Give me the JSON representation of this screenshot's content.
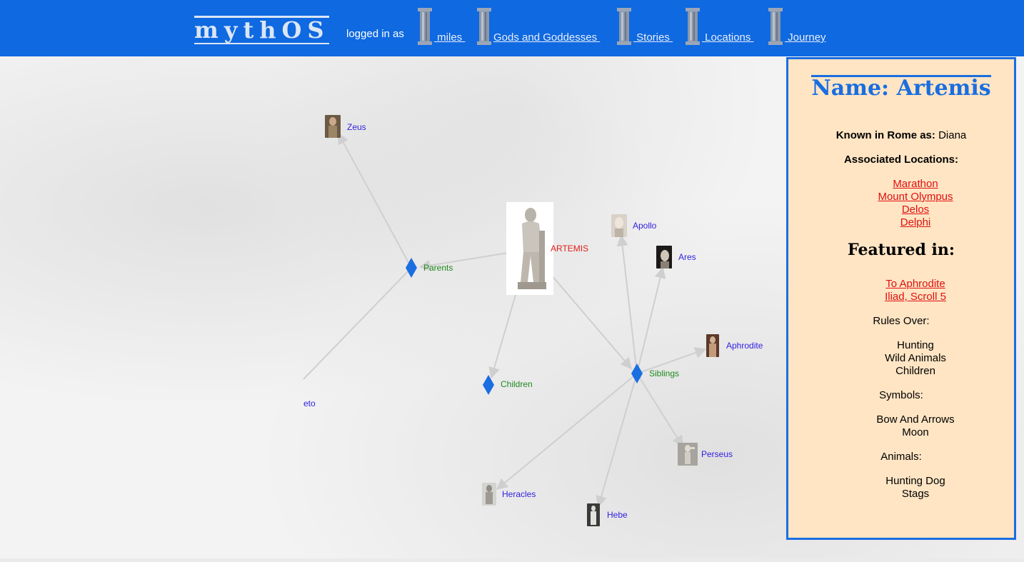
{
  "header": {
    "logo": "mythOS",
    "login_text": "logged in as",
    "nav": [
      {
        "label": " miles ",
        "icon": "column-icon"
      },
      {
        "label": "Gods and Goddesses ",
        "icon": "column-icon"
      },
      {
        "label": " Stories ",
        "icon": "column-icon"
      },
      {
        "label": " Locations ",
        "icon": "column-icon"
      },
      {
        "label": " Journey",
        "icon": "column-icon"
      }
    ]
  },
  "graph": {
    "center": {
      "label": "ARTEMIS"
    },
    "hubs": {
      "parents": "Parents",
      "children": "Children",
      "siblings": "Siblings"
    },
    "gods": {
      "zeus": "Zeus",
      "leto": "eto",
      "apollo": "Apollo",
      "ares": "Ares",
      "aphrodite": "Aphrodite",
      "perseus": "Perseus",
      "heracles": "Heracles",
      "hebe": "Hebe"
    },
    "colors": {
      "god_label": "#2f1fe0",
      "hub_label": "#1e8a1e",
      "center_label": "#e0201c",
      "hub": "#1a6ee0",
      "edge": "#cfcfcf"
    }
  },
  "panel": {
    "title": "Name: Artemis",
    "rome_label": "Known in Rome as:",
    "rome_value": " Diana",
    "locations_label": "Associated Locations:",
    "locations": [
      "Marathon",
      "Mount Olympus",
      "Delos",
      "Delphi"
    ],
    "featured_label": "Featured in:",
    "featured": [
      "To Aphrodite",
      "Iliad, Scroll 5"
    ],
    "rules_label": "Rules Over:",
    "rules": [
      "Hunting",
      "Wild Animals",
      "Children"
    ],
    "symbols_label": "Symbols:",
    "symbols": [
      "Bow And Arrows",
      "Moon"
    ],
    "animals_label": "Animals:",
    "animals": [
      "Hunting Dog",
      "Stags"
    ],
    "colors": {
      "background": "#ffe5c4",
      "border": "#1a6ee0",
      "link": "#e01010"
    }
  }
}
